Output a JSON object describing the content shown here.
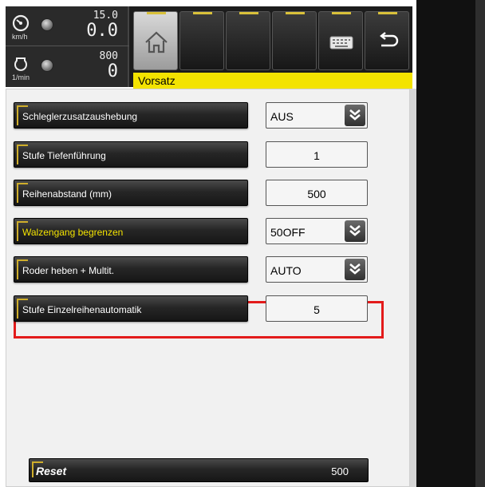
{
  "gauges": {
    "speed": {
      "icon": "speedometer-icon",
      "unit": "km/h",
      "limit": "15.0",
      "value": "0.0"
    },
    "rpm": {
      "icon": "engine-icon",
      "unit": "1/min",
      "limit": "800",
      "value": "0"
    }
  },
  "toolbar": {
    "buttons": [
      "home-icon",
      "",
      "",
      "",
      "keyboard-icon",
      "back-icon"
    ]
  },
  "title": "Vorsatz",
  "rows": [
    {
      "label": "Schleglerzusatzaushebung",
      "type": "select",
      "value": "AUS"
    },
    {
      "label": "Stufe Tiefenführung",
      "type": "value",
      "value": "1"
    },
    {
      "label": "Reihenabstand (mm)",
      "type": "value",
      "value": "500"
    },
    {
      "label": "Walzengang begrenzen",
      "type": "select",
      "value": "50OFF",
      "active": true
    },
    {
      "label": "Roder heben + Multit.",
      "type": "select",
      "value": "AUTO"
    },
    {
      "label": "Stufe Einzelreihenautomatik",
      "type": "value",
      "value": "5"
    }
  ],
  "reset": {
    "label": "Reset",
    "value": "500"
  },
  "colors": {
    "accent_yellow": "#f3e300",
    "highlight_red": "#e31b1b",
    "button_dark": "#1c1c1c"
  }
}
